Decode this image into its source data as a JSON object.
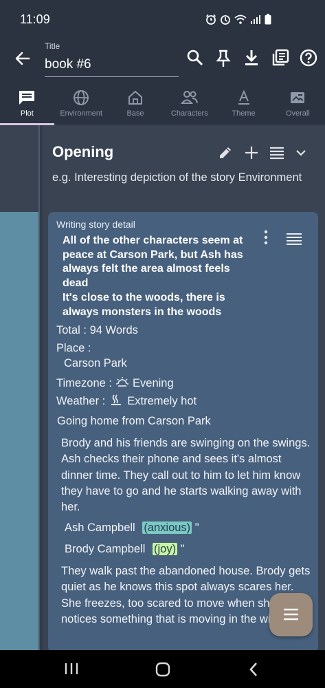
{
  "status_bar": {
    "time": "11:09",
    "icons": [
      "moon-icon",
      "alarm-icon",
      "wifi-icon",
      "signal-icon",
      "battery-icon"
    ]
  },
  "app_bar": {
    "title_label": "Title",
    "title_value": "book #6",
    "icons": [
      "back-arrow-icon",
      "search-icon",
      "pin-icon",
      "download-icon",
      "library-icon",
      "help-icon"
    ]
  },
  "tabs": [
    {
      "label": "Plot",
      "icon": "chat-icon",
      "active": true
    },
    {
      "label": "Environment",
      "icon": "globe-icon",
      "active": false
    },
    {
      "label": "Base",
      "icon": "home-icon",
      "active": false
    },
    {
      "label": "Characters",
      "icon": "people-icon",
      "active": false
    },
    {
      "label": "Theme",
      "icon": "text-icon",
      "active": false
    },
    {
      "label": "Overall",
      "icon": "image-icon",
      "active": false
    }
  ],
  "section": {
    "title": "Opening",
    "description": "e.g. Interesting depiction of the story Environment",
    "actions": [
      "edit-icon",
      "add-icon",
      "list-icon",
      "chevron-down-icon"
    ]
  },
  "card": {
    "label": "Writing story detail",
    "detail": "All of the other characters seem at peace at Carson Park, but Ash has always felt the area almost feels dead\nIt's close to the woods, there is always monsters in the woods",
    "total": "Total : 94 Words",
    "place_label": "Place :",
    "place_value": "Carson Park",
    "timezone_label": "Timezone :",
    "timezone_value": "Evening",
    "weather_label": "Weather :",
    "weather_value": "Extremely hot",
    "scene_title": "Going home from Carson Park",
    "paragraph_1": "Brody and his friends are swinging on the swings. Ash checks their phone and sees it's almost dinner time. They call out to him to let him know they have to go and he starts walking away with her.",
    "dialogs": [
      {
        "name": "Ash Campbell",
        "emotion": "(anxious)",
        "quote": "\""
      },
      {
        "name": "Brody Campbell",
        "emotion": "(joy)",
        "quote": "\""
      }
    ],
    "paragraph_2": "They walk past the abandoned house. Brody gets quiet as he knows this spot always scares her. She freezes, too scared to move when she notices something that is moving in the window"
  },
  "colors": {
    "background": "#303a49",
    "card": "#47607d",
    "accent_strip": "#5d8ea3",
    "fab": "#9d8b7b",
    "anxious": "#7ac9c4",
    "joy": "#c5f5a1"
  },
  "fab_icon": "menu-icon",
  "nav_icons": [
    "recent-apps-icon",
    "home-nav-icon",
    "back-nav-icon"
  ]
}
